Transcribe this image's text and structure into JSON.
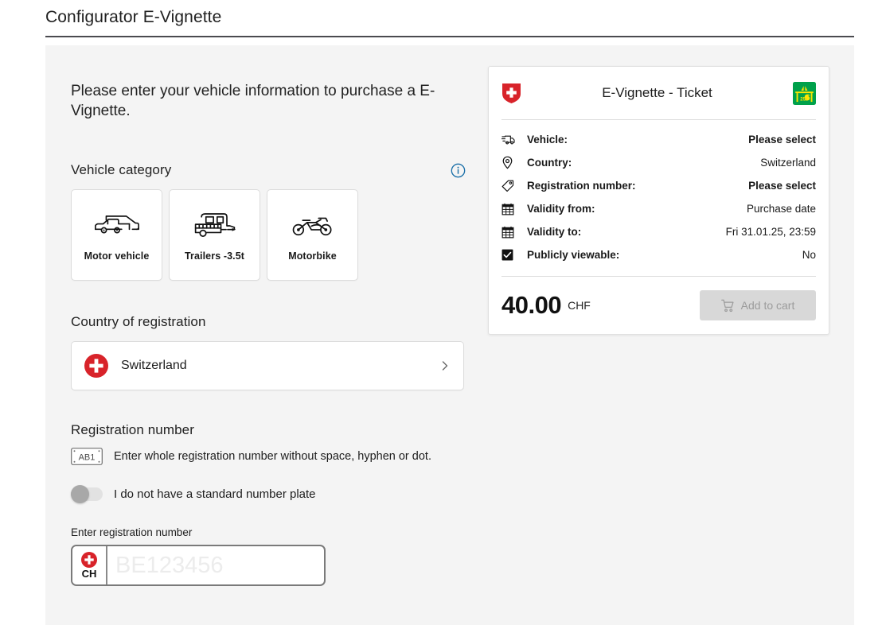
{
  "header": {
    "title": "Configurator E-Vignette"
  },
  "main": {
    "intro": "Please enter your vehicle information to purchase a E-Vignette.",
    "vehicle_category": {
      "title": "Vehicle category",
      "info_icon": "info-circle-icon",
      "options": [
        {
          "label": "Motor vehicle",
          "icon": "car-van-icon"
        },
        {
          "label": "Trailers -3.5t",
          "icon": "caravan-trailer-icon"
        },
        {
          "label": "Motorbike",
          "icon": "motorbike-icon"
        }
      ]
    },
    "country_of_registration": {
      "title": "Country of registration",
      "selected": "Switzerland",
      "flag_icon": "swiss-flag-round-icon",
      "chevron_icon": "chevron-right-icon"
    },
    "registration_number": {
      "title": "Registration number",
      "plate_icon": "license-plate-icon",
      "plate_icon_text": "AB1",
      "hint": "Enter whole registration number without space, hyphen or dot.",
      "toggle_label": "I do not have a standard number plate",
      "toggle_state": "off",
      "field_label": "Enter registration number",
      "country_code": "CH",
      "country_flag_icon": "swiss-flag-round-icon",
      "input_value": "",
      "input_placeholder": "BE123456"
    }
  },
  "ticket": {
    "title": "E-Vignette - Ticket",
    "shield_icon": "swiss-coat-of-arms-shield-icon",
    "vignette_icon": "motorway-vignette-icon",
    "rows": [
      {
        "icon": "truck-icon",
        "label": "Vehicle:",
        "value": "Please select",
        "strong": true
      },
      {
        "icon": "location-pin-icon",
        "label": "Country:",
        "value": "Switzerland",
        "strong": false
      },
      {
        "icon": "tag-icon",
        "label": "Registration number:",
        "value": "Please select",
        "strong": true
      },
      {
        "icon": "calendar-icon",
        "label": "Validity from:",
        "value": "Purchase date",
        "strong": false
      },
      {
        "icon": "calendar-icon",
        "label": "Validity to:",
        "value": "Fri 31.01.25, 23:59",
        "strong": false
      },
      {
        "icon": "checkbox-checked-icon",
        "label": "Publicly viewable:",
        "value": "No",
        "strong": false
      }
    ],
    "price": "40.00",
    "currency": "CHF",
    "cart_button": {
      "label": "Add to cart",
      "icon": "shopping-cart-icon",
      "disabled": true
    }
  },
  "colors": {
    "swiss_red": "#d8232a",
    "vignette_green": "#00a14b",
    "vignette_yellow": "#ffe500",
    "info_blue": "#1a6fa8",
    "page_bg": "#f4f4f4"
  }
}
